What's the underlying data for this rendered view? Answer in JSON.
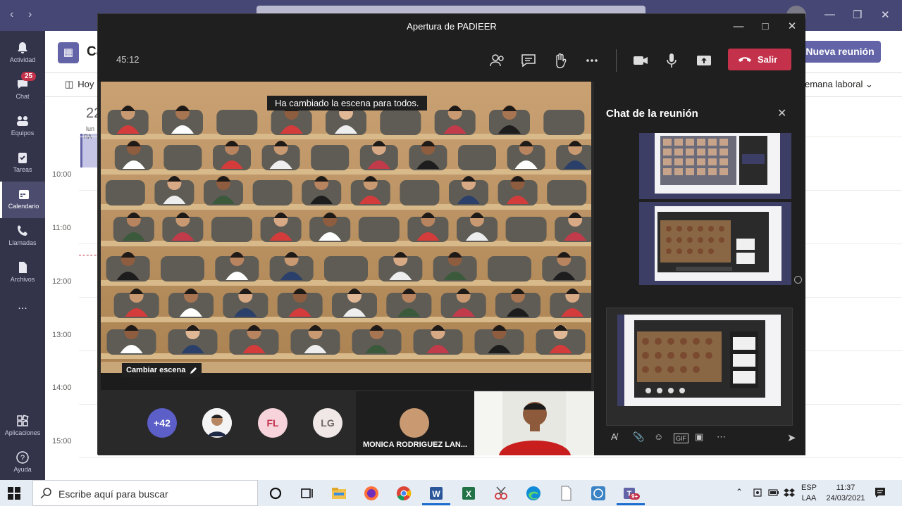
{
  "teams": {
    "rail": [
      {
        "label": "Actividad",
        "icon": "bell-icon"
      },
      {
        "label": "Chat",
        "icon": "chat-icon",
        "badge": "25"
      },
      {
        "label": "Equipos",
        "icon": "teams-icon"
      },
      {
        "label": "Tareas",
        "icon": "tasks-icon"
      },
      {
        "label": "Calendario",
        "icon": "calendar-icon",
        "active": true
      },
      {
        "label": "Llamadas",
        "icon": "phone-icon"
      },
      {
        "label": "Archivos",
        "icon": "files-icon"
      },
      {
        "label": "...",
        "icon": "more-icon"
      },
      {
        "label": "Aplicaciones",
        "icon": "apps-icon"
      },
      {
        "label": "Ayuda",
        "icon": "help-icon"
      }
    ],
    "header": {
      "title": "Ca",
      "new_meeting": "Nueva reunión"
    },
    "toolbar": {
      "today": "Hoy",
      "view": "emana laboral"
    },
    "day": {
      "num": "22",
      "label": "lun",
      "event": "RA"
    },
    "hours": [
      "10:00",
      "11:00",
      "12:00",
      "13:00",
      "14:00",
      "15:00"
    ]
  },
  "meeting": {
    "title": "Apertura de PADIEER",
    "timer": "45:12",
    "leave": "Salir",
    "toast": "Ha cambiado la escena para todos.",
    "change_scene": "Cambiar escena",
    "roster": {
      "more": "+42",
      "initials": [
        "FL",
        "LG"
      ],
      "tile_name": "MONICA RODRIGUEZ LAN..."
    },
    "chat_title": "Chat de la reunión"
  },
  "taskbar": {
    "search": "Escribe aquí para buscar",
    "lang": "ESP",
    "layout": "LAA",
    "time": "11:37",
    "date": "24/03/2021",
    "teams_badge": "9+"
  },
  "colors": {
    "teams_purple": "#6264a7",
    "leave_red": "#c4314b",
    "rail": "#33344a",
    "titlebar": "#464775"
  }
}
